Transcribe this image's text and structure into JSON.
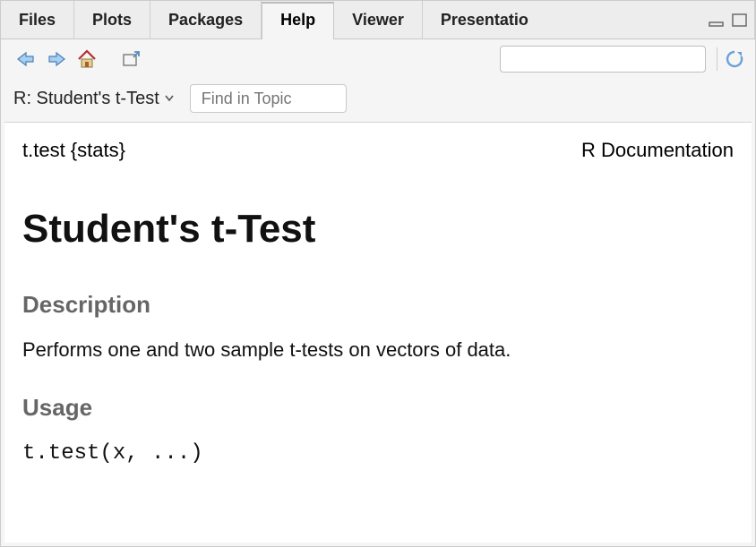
{
  "tabs": {
    "items": [
      "Files",
      "Plots",
      "Packages",
      "Help",
      "Viewer",
      "Presentatio"
    ],
    "activeIndex": 3
  },
  "toolbar": {
    "search_placeholder": ""
  },
  "crumb": {
    "label": "R: Student's t-Test"
  },
  "find": {
    "placeholder": "Find in Topic"
  },
  "doc": {
    "topic": "t.test {stats}",
    "source": "R Documentation",
    "title": "Student's t-Test",
    "section_desc": "Description",
    "description_text": "Performs one and two sample t-tests on vectors of data.",
    "section_usage": "Usage",
    "usage_code": "t.test(x, ...)"
  }
}
